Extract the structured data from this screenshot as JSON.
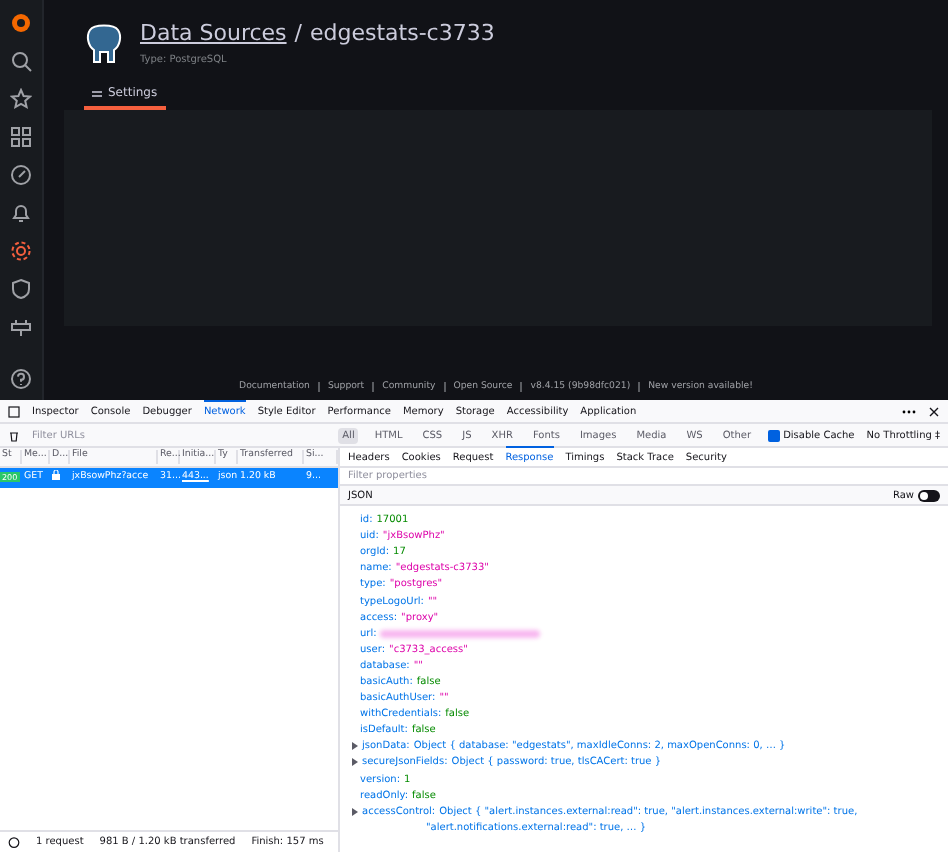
{
  "sidebar": {
    "items": [
      {
        "selected": false
      },
      {
        "selected": false
      },
      {
        "selected": false
      },
      {
        "selected": false
      },
      {
        "selected": false
      },
      {
        "selected": true
      },
      {
        "selected": false
      },
      {
        "selected": false
      }
    ]
  },
  "header": {
    "breadcrumb_link": "Data Sources",
    "separator": "/",
    "title": "edgestats-c3733",
    "subtitle": "Type: PostgreSQL"
  },
  "tabs": [
    {
      "label": "Settings",
      "selected": true
    }
  ],
  "footer": {
    "links": [
      "Documentation",
      "Support",
      "Community",
      "Open Source",
      "v8.4.15 (9b98dfc021)",
      "New version available!"
    ]
  },
  "devtools": {
    "tools": [
      {
        "label": "Inspector",
        "selected": false
      },
      {
        "label": "Console",
        "selected": false
      },
      {
        "label": "Debugger",
        "selected": false
      },
      {
        "label": "Network",
        "selected": true
      },
      {
        "label": "Style Editor",
        "selected": false
      },
      {
        "label": "Performance",
        "selected": false
      },
      {
        "label": "Memory",
        "selected": false
      },
      {
        "label": "Storage",
        "selected": false
      },
      {
        "label": "Accessibility",
        "selected": false
      },
      {
        "label": "Application",
        "selected": false
      }
    ],
    "filter_placeholder": "Filter URLs",
    "type_filters": [
      {
        "label": "All",
        "selected": true
      },
      {
        "label": "HTML",
        "selected": false
      },
      {
        "label": "CSS",
        "selected": false
      },
      {
        "label": "JS",
        "selected": false
      },
      {
        "label": "XHR",
        "selected": false
      },
      {
        "label": "Fonts",
        "selected": false
      },
      {
        "label": "Images",
        "selected": false
      },
      {
        "label": "Media",
        "selected": false
      },
      {
        "label": "WS",
        "selected": false
      },
      {
        "label": "Other",
        "selected": false
      }
    ],
    "disable_cache": {
      "label": "Disable Cache",
      "checked": true
    },
    "throttling": "No Throttling ‡",
    "columns": [
      "St",
      "Me...",
      "D...",
      "File",
      "Re...",
      "Initia...",
      "Ty",
      "Transferred",
      "Si..."
    ],
    "requests": [
      {
        "status": "200",
        "method": "GET",
        "file": "jxBsowPhz?acce",
        "re": "31...",
        "initiator": "443...",
        "type": "json",
        "transferred": "1.20 kB",
        "size": "9...",
        "selected": true
      }
    ],
    "detail_tabs": [
      {
        "label": "Headers",
        "selected": false
      },
      {
        "label": "Cookies",
        "selected": false
      },
      {
        "label": "Request",
        "selected": false
      },
      {
        "label": "Response",
        "selected": true
      },
      {
        "label": "Timings",
        "selected": false
      },
      {
        "label": "Stack Trace",
        "selected": false
      },
      {
        "label": "Security",
        "selected": false
      }
    ],
    "props_placeholder": "Filter properties",
    "section": "JSON",
    "raw": {
      "label": "Raw",
      "on": false
    },
    "json_lines": [
      {
        "kind": "number",
        "key": "id:",
        "value": "17001"
      },
      {
        "kind": "string",
        "key": "uid:",
        "value": "\"jxBsowPhz\""
      },
      {
        "kind": "number",
        "key": "orgId:",
        "value": "17"
      },
      {
        "kind": "string",
        "key": "name:",
        "value": "\"edgestats-c3733\""
      },
      {
        "kind": "string",
        "key": "type:",
        "value": "\"postgres\""
      },
      {
        "kind": "string",
        "key": "typeLogoUrl:",
        "value": "\"\""
      },
      {
        "kind": "string",
        "key": "access:",
        "value": "\"proxy\""
      },
      {
        "kind": "redacted",
        "key": "url:"
      },
      {
        "kind": "string",
        "key": "user:",
        "value": "\"c3733_access\""
      },
      {
        "kind": "string",
        "key": "database:",
        "value": "\"\""
      },
      {
        "kind": "number",
        "key": "basicAuth:",
        "value": "false"
      },
      {
        "kind": "string",
        "key": "basicAuthUser:",
        "value": "\"\""
      },
      {
        "kind": "number",
        "key": "withCredentials:",
        "value": "false"
      },
      {
        "kind": "number",
        "key": "isDefault:",
        "value": "false"
      },
      {
        "kind": "object",
        "key": "jsonData:",
        "value": "Object { database: \"edgestats\", maxIdleConns: 2, maxOpenConns: 0, … }"
      },
      {
        "kind": "object",
        "key": "secureJsonFields:",
        "value": "Object { password: true, tlsCACert: true }"
      },
      {
        "kind": "number",
        "key": "version:",
        "value": "1"
      },
      {
        "kind": "number",
        "key": "readOnly:",
        "value": "false"
      },
      {
        "kind": "object",
        "key": "accessControl:",
        "value": "Object { \"alert.instances.external:read\": true, \"alert.instances.external:write\": true,",
        "value2": "\"alert.notifications.external:read\": true, … }"
      }
    ],
    "status": {
      "requests": "1 request",
      "transferred": "981 B / 1.20 kB transferred",
      "finish": "Finish: 157 ms"
    }
  }
}
